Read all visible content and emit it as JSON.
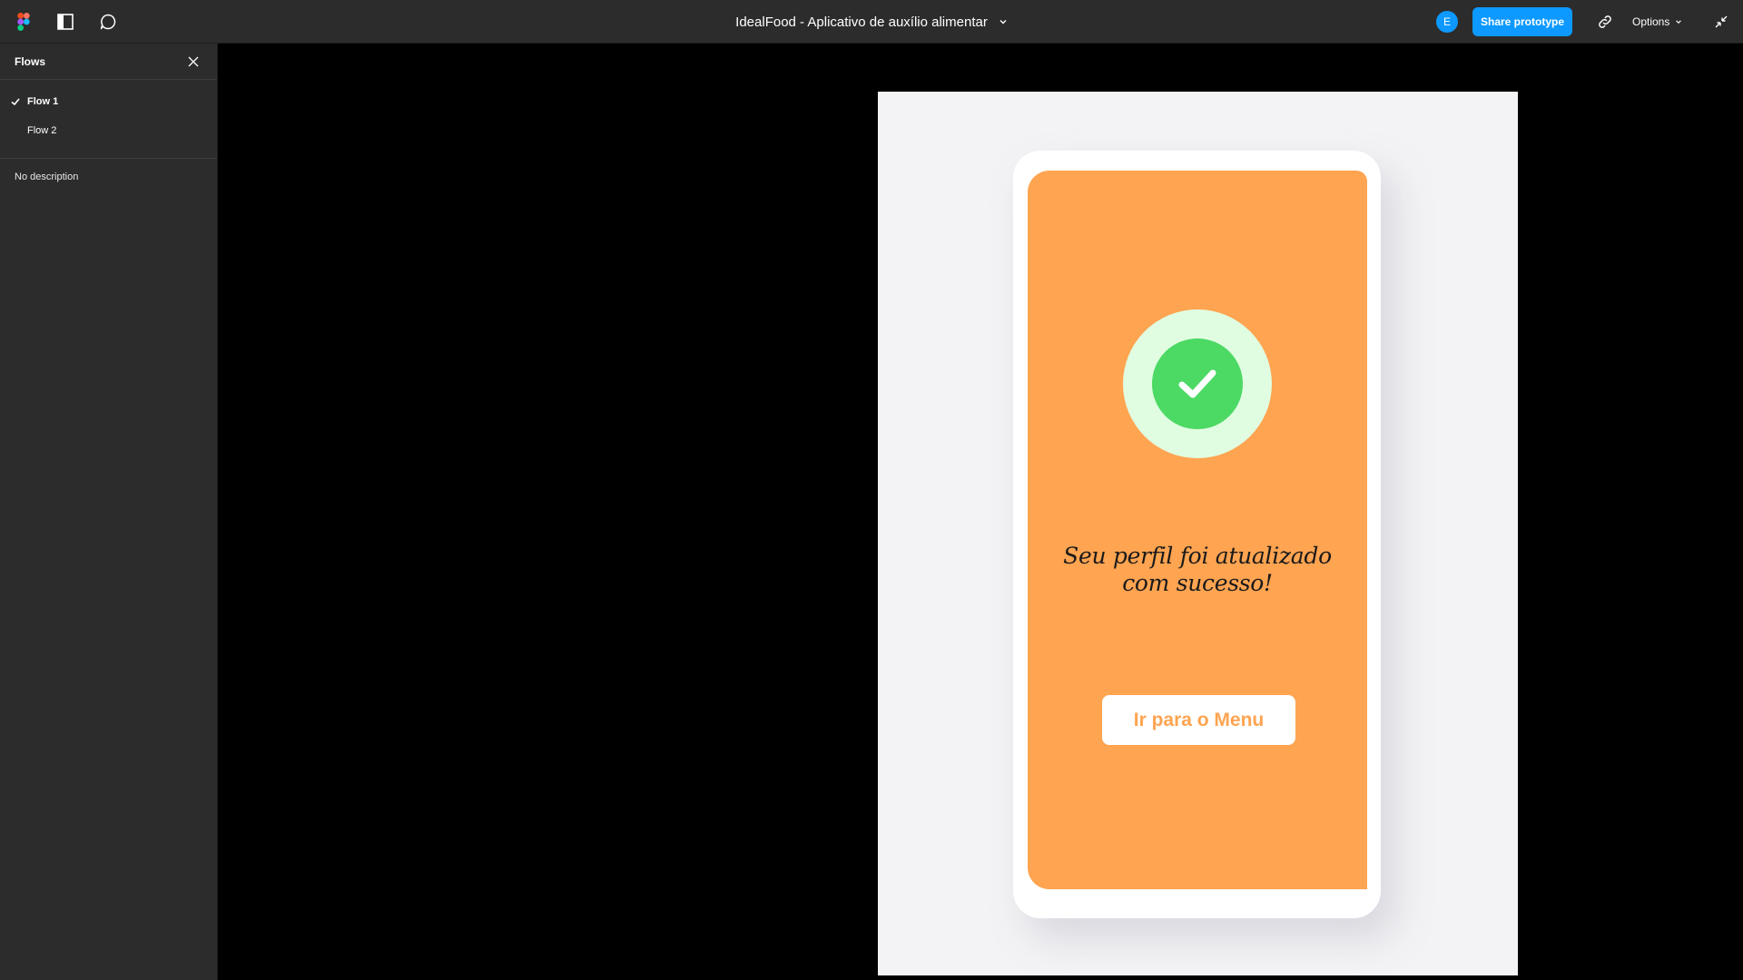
{
  "app": {
    "title": "IdealFood - Aplicativo de auxílio alimentar",
    "avatar_initial": "E",
    "share_label": "Share prototype",
    "options_label": "Options"
  },
  "sidebar": {
    "title": "Flows",
    "flows": [
      {
        "label": "Flow 1",
        "active": true
      },
      {
        "label": "Flow 2",
        "active": false
      }
    ],
    "description": "No description"
  },
  "prototype": {
    "message": "Seu perfil foi atualizado com sucesso!",
    "button_label": "Ir para o Menu"
  },
  "colors": {
    "accent": "#0d99ff",
    "screen_bg": "#ffa451",
    "check_outer": "#e0fde1",
    "check_inner": "#4cd964"
  },
  "icons": {
    "logo": "figma-logo-icon",
    "panel": "sidebar-toggle-icon",
    "comment": "comment-icon",
    "link": "link-icon",
    "collapse": "collapse-icon",
    "close": "close-icon",
    "check": "checkmark-icon"
  }
}
